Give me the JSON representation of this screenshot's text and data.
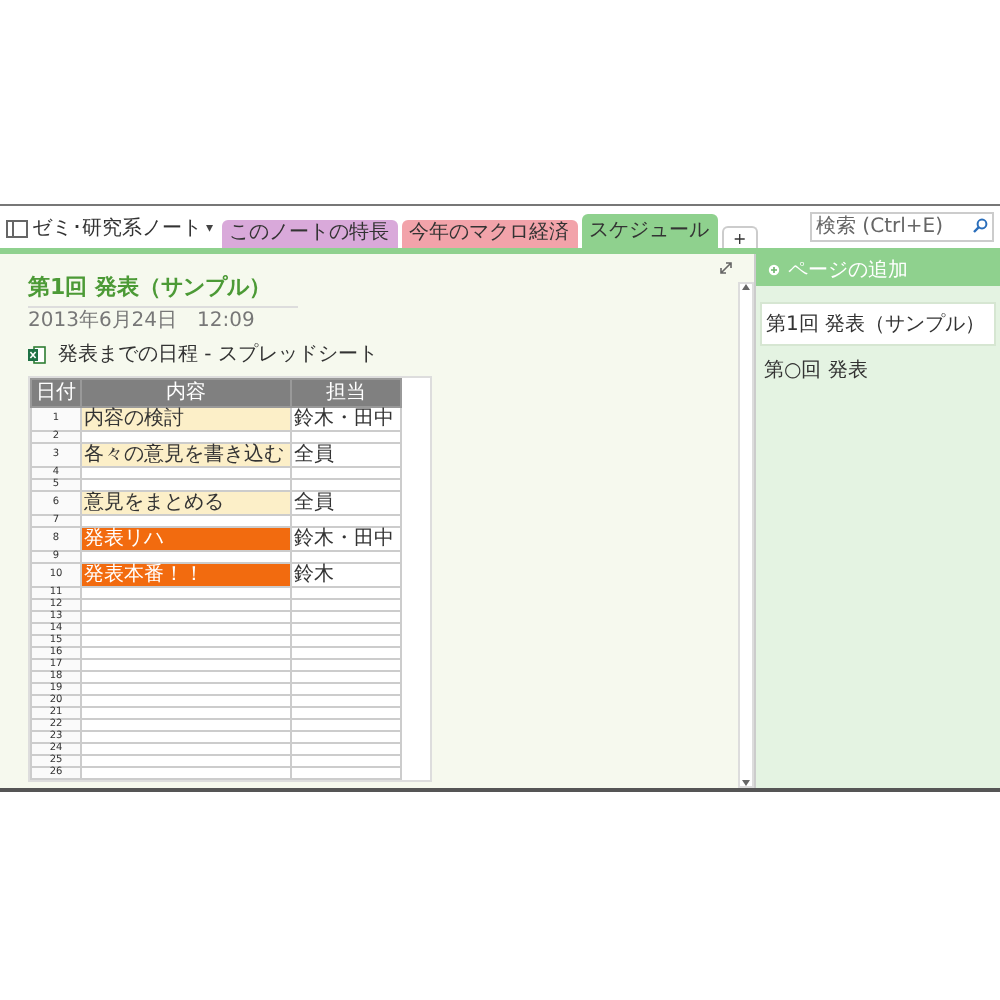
{
  "notebook": {
    "title": "ゼミ･研究系ノート",
    "caret": "▾"
  },
  "tabs": [
    {
      "label": "このノートの特長",
      "color": "#d9a9da",
      "selected": false
    },
    {
      "label": "今年のマクロ経済",
      "color": "#f2a3aa",
      "selected": false
    },
    {
      "label": "スケジュール",
      "color": "#8fd18e",
      "selected": true
    },
    {
      "label": "+",
      "color": "#ffffff",
      "selected": false
    }
  ],
  "search": {
    "placeholder": "検索 (Ctrl+E)"
  },
  "page": {
    "title": "第1回 発表（サンプル）",
    "date": "2013年6月24日",
    "time": "12:09",
    "attachment": {
      "title": "発表までの日程 - スプレッドシート"
    },
    "sheet": {
      "columns": [
        "日付",
        "内容",
        "担当"
      ],
      "rows": [
        {
          "n": "1",
          "task": "内容の検討",
          "owner": "鈴木・田中",
          "kind": "note"
        },
        {
          "n": "2",
          "task": "",
          "owner": "",
          "kind": "plain"
        },
        {
          "n": "3",
          "task": "各々の意見を書き込む",
          "owner": "全員",
          "kind": "note"
        },
        {
          "n": "4",
          "task": "",
          "owner": "",
          "kind": "plain"
        },
        {
          "n": "5",
          "task": "",
          "owner": "",
          "kind": "plain"
        },
        {
          "n": "6",
          "task": "意見をまとめる",
          "owner": "全員",
          "kind": "note"
        },
        {
          "n": "7",
          "task": "",
          "owner": "",
          "kind": "plain"
        },
        {
          "n": "8",
          "task": "発表リハ",
          "owner": "鈴木・田中",
          "kind": "alert"
        },
        {
          "n": "9",
          "task": "",
          "owner": "",
          "kind": "plain"
        },
        {
          "n": "10",
          "task": "発表本番！！",
          "owner": "鈴木",
          "kind": "alert"
        },
        {
          "n": "11",
          "task": "",
          "owner": "",
          "kind": "plain"
        },
        {
          "n": "12",
          "task": "",
          "owner": "",
          "kind": "plain"
        },
        {
          "n": "13",
          "task": "",
          "owner": "",
          "kind": "plain"
        },
        {
          "n": "14",
          "task": "",
          "owner": "",
          "kind": "plain"
        },
        {
          "n": "15",
          "task": "",
          "owner": "",
          "kind": "plain"
        },
        {
          "n": "16",
          "task": "",
          "owner": "",
          "kind": "plain"
        },
        {
          "n": "17",
          "task": "",
          "owner": "",
          "kind": "plain"
        },
        {
          "n": "18",
          "task": "",
          "owner": "",
          "kind": "plain"
        },
        {
          "n": "19",
          "task": "",
          "owner": "",
          "kind": "plain"
        },
        {
          "n": "20",
          "task": "",
          "owner": "",
          "kind": "plain"
        },
        {
          "n": "21",
          "task": "",
          "owner": "",
          "kind": "plain"
        },
        {
          "n": "22",
          "task": "",
          "owner": "",
          "kind": "plain"
        },
        {
          "n": "23",
          "task": "",
          "owner": "",
          "kind": "plain"
        },
        {
          "n": "24",
          "task": "",
          "owner": "",
          "kind": "plain"
        },
        {
          "n": "25",
          "task": "",
          "owner": "",
          "kind": "plain"
        },
        {
          "n": "26",
          "task": "",
          "owner": "",
          "kind": "plain"
        }
      ]
    }
  },
  "pages_panel": {
    "add_label": "ページの追加",
    "pages": [
      {
        "title": "第1回 発表（サンプル）",
        "selected": true
      },
      {
        "title": "第○回 発表",
        "selected": false
      }
    ]
  }
}
